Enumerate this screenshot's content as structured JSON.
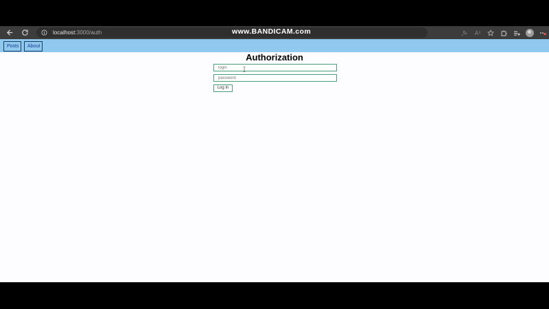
{
  "browser": {
    "url_host": "localhost",
    "url_path": ":3000/auth"
  },
  "watermark": "www.BANDICAM.com",
  "app_nav": {
    "items": [
      {
        "label": "Posts"
      },
      {
        "label": "About"
      }
    ]
  },
  "auth": {
    "title": "Authorization",
    "login_placeholder": "login",
    "password_placeholder": "password",
    "submit_label": "Log In"
  },
  "colors": {
    "nav_bar": "#90c9f0",
    "field_border": "#4a9e7a",
    "browser_chrome": "#3c3c3c"
  }
}
